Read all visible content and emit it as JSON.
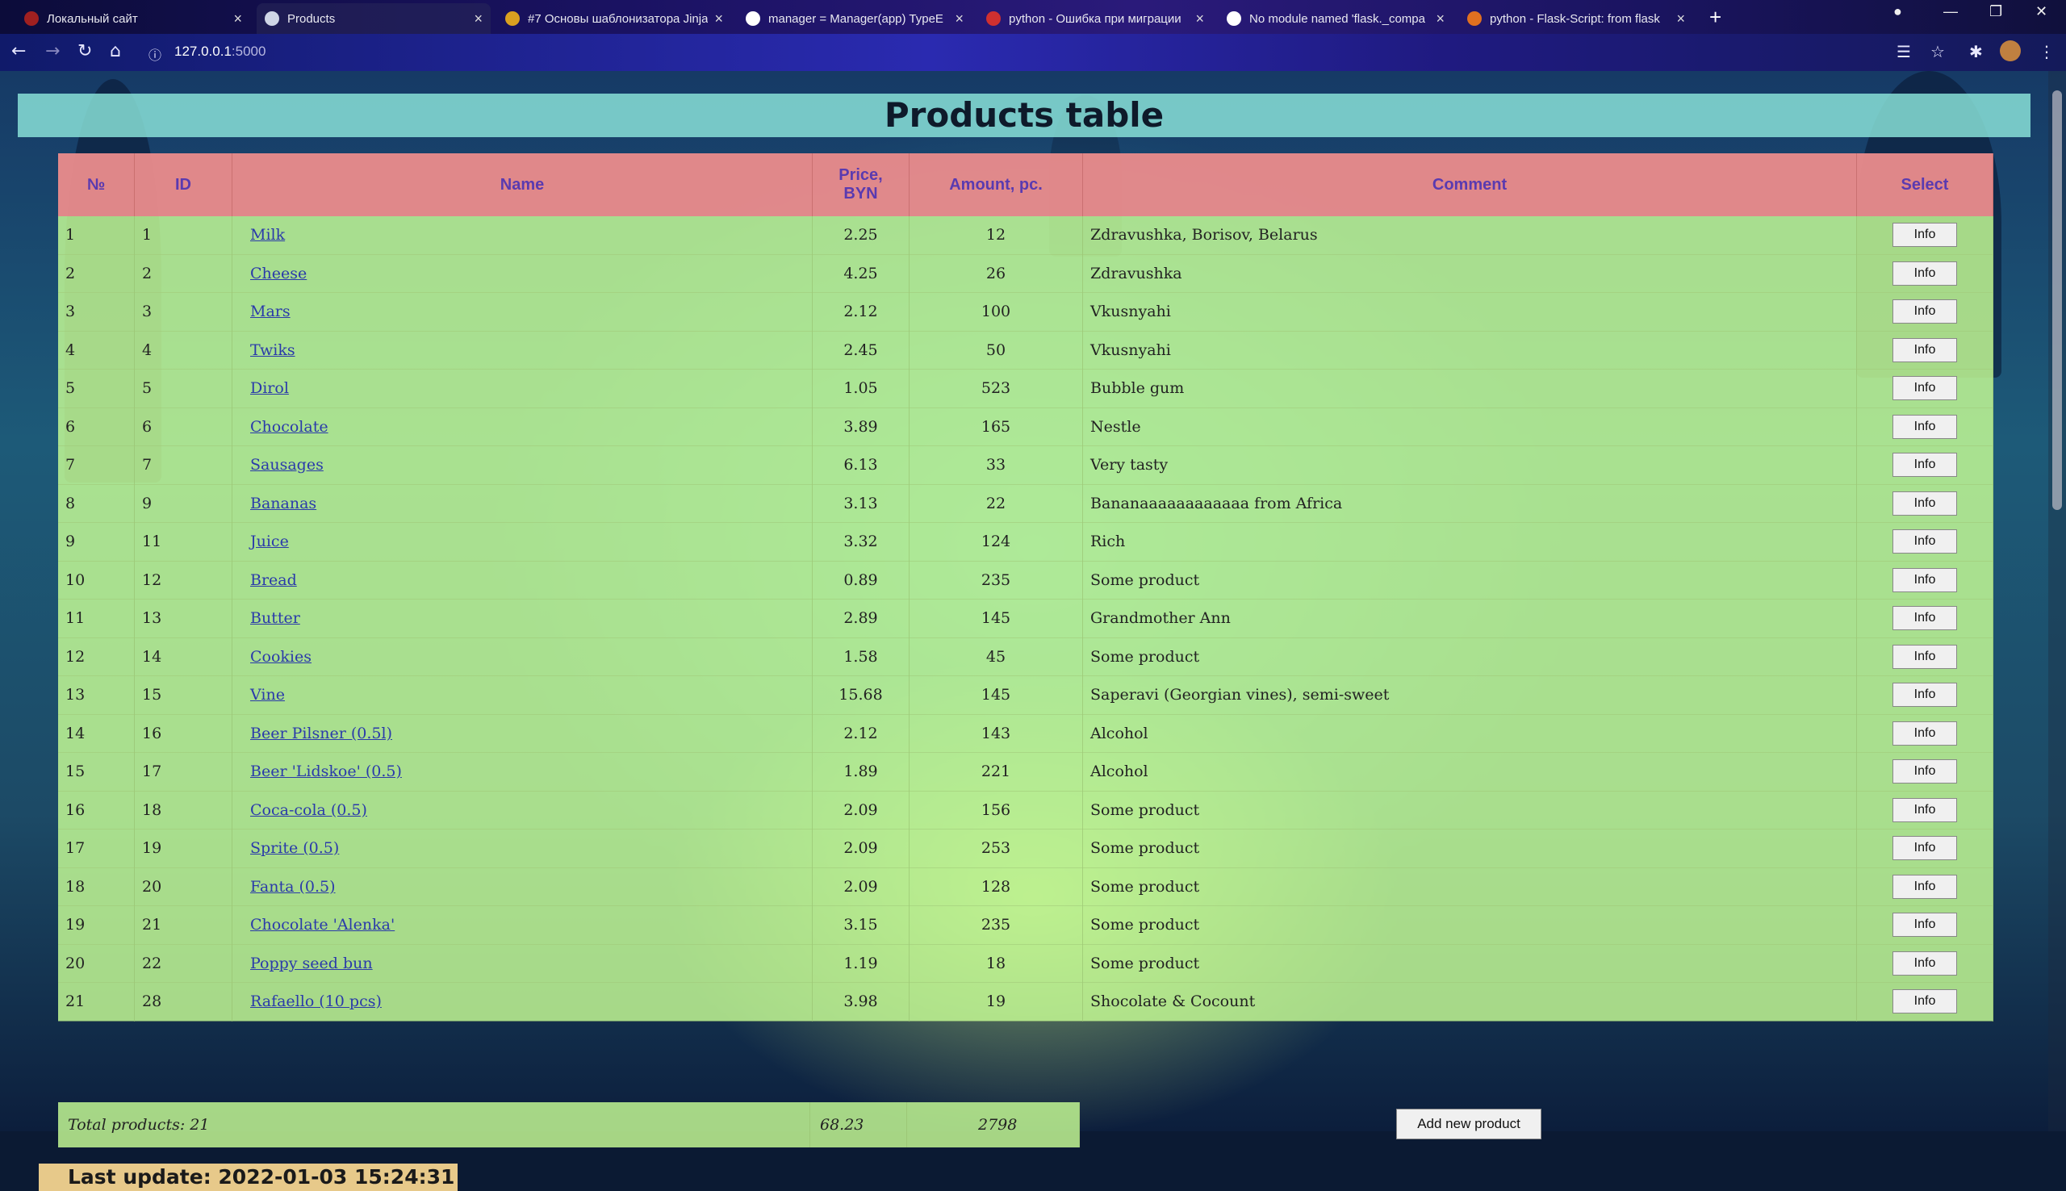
{
  "browser": {
    "tabs": [
      {
        "label": "Локальный сайт",
        "fav_color": "#a02020",
        "active": false
      },
      {
        "label": "Products",
        "fav_color": "#cfd6e6",
        "active": true
      },
      {
        "label": "#7 Основы шаблонизатора Jinja",
        "fav_color": "#d9a020",
        "active": false
      },
      {
        "label": "manager = Manager(app) TypeE",
        "fav_color": "#ffffff",
        "active": false
      },
      {
        "label": "python - Ошибка при миграции",
        "fav_color": "#d03030",
        "active": false
      },
      {
        "label": "No module named 'flask._compa",
        "fav_color": "#ffffff",
        "active": false
      },
      {
        "label": "python - Flask-Script: from flask",
        "fav_color": "#e07020",
        "active": false
      }
    ],
    "url_host": "127.0.0.1",
    "url_port": ":5000"
  },
  "page": {
    "title": "Products table",
    "headers": {
      "num": "№",
      "id": "ID",
      "name": "Name",
      "price": "Price, BYN",
      "amount": "Amount, pc.",
      "comment": "Comment",
      "select": "Select"
    },
    "info_label": "Info",
    "rows": [
      {
        "num": "1",
        "id": "1",
        "name": "Milk",
        "price": "2.25",
        "amount": "12",
        "comment": "Zdravushka, Borisov, Belarus"
      },
      {
        "num": "2",
        "id": "2",
        "name": "Cheese",
        "price": "4.25",
        "amount": "26",
        "comment": "Zdravushka"
      },
      {
        "num": "3",
        "id": "3",
        "name": "Mars",
        "price": "2.12",
        "amount": "100",
        "comment": "Vkusnyahi"
      },
      {
        "num": "4",
        "id": "4",
        "name": "Twiks",
        "price": "2.45",
        "amount": "50",
        "comment": "Vkusnyahi"
      },
      {
        "num": "5",
        "id": "5",
        "name": "Dirol",
        "price": "1.05",
        "amount": "523",
        "comment": "Bubble gum"
      },
      {
        "num": "6",
        "id": "6",
        "name": "Chocolate",
        "price": "3.89",
        "amount": "165",
        "comment": "Nestle"
      },
      {
        "num": "7",
        "id": "7",
        "name": "Sausages",
        "price": "6.13",
        "amount": "33",
        "comment": "Very tasty"
      },
      {
        "num": "8",
        "id": "9",
        "name": "Bananas",
        "price": "3.13",
        "amount": "22",
        "comment": "Bananaaaaaaaaaaaa from Africa"
      },
      {
        "num": "9",
        "id": "11",
        "name": "Juice",
        "price": "3.32",
        "amount": "124",
        "comment": "Rich"
      },
      {
        "num": "10",
        "id": "12",
        "name": "Bread",
        "price": "0.89",
        "amount": "235",
        "comment": "Some product"
      },
      {
        "num": "11",
        "id": "13",
        "name": "Butter",
        "price": "2.89",
        "amount": "145",
        "comment": "Grandmother Ann"
      },
      {
        "num": "12",
        "id": "14",
        "name": "Cookies",
        "price": "1.58",
        "amount": "45",
        "comment": "Some product"
      },
      {
        "num": "13",
        "id": "15",
        "name": "Vine",
        "price": "15.68",
        "amount": "145",
        "comment": "Saperavi (Georgian vines), semi-sweet"
      },
      {
        "num": "14",
        "id": "16",
        "name": "Beer Pilsner (0.5l)",
        "price": "2.12",
        "amount": "143",
        "comment": "Alcohol"
      },
      {
        "num": "15",
        "id": "17",
        "name": "Beer 'Lidskoe' (0.5)",
        "price": "1.89",
        "amount": "221",
        "comment": "Alcohol"
      },
      {
        "num": "16",
        "id": "18",
        "name": "Coca-cola (0.5)",
        "price": "2.09",
        "amount": "156",
        "comment": "Some product"
      },
      {
        "num": "17",
        "id": "19",
        "name": "Sprite (0.5)",
        "price": "2.09",
        "amount": "253",
        "comment": "Some product"
      },
      {
        "num": "18",
        "id": "20",
        "name": "Fanta (0.5)",
        "price": "2.09",
        "amount": "128",
        "comment": "Some product"
      },
      {
        "num": "19",
        "id": "21",
        "name": "Chocolate 'Alenka'",
        "price": "3.15",
        "amount": "235",
        "comment": "Some product"
      },
      {
        "num": "20",
        "id": "22",
        "name": "Poppy seed bun",
        "price": "1.19",
        "amount": "18",
        "comment": "Some product"
      },
      {
        "num": "21",
        "id": "28",
        "name": "Rafaello (10 pcs)",
        "price": "3.98",
        "amount": "19",
        "comment": "Shocolate & Cocount"
      }
    ],
    "totals": {
      "label": "Total products: 21",
      "price": "68.23",
      "amount": "2798"
    },
    "add_button": "Add new product",
    "last_update": "Last update: 2022-01-03 15:24:31"
  }
}
